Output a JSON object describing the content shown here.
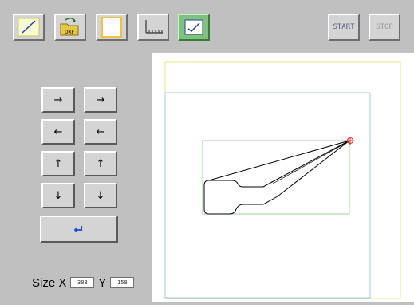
{
  "toolbar": {
    "buttons": [
      {
        "icon": "new-drawing-icon"
      },
      {
        "icon": "open-dxf-icon",
        "label": "DXF"
      },
      {
        "icon": "blank-frame-icon"
      },
      {
        "icon": "ruler-icon"
      },
      {
        "icon": "checkmark-view-icon",
        "active": true
      }
    ],
    "start_label": "START",
    "stop_label": "STOP"
  },
  "jog": {
    "buttons": [
      {
        "label": "→"
      },
      {
        "label": "→"
      },
      {
        "label": "←"
      },
      {
        "label": "←"
      },
      {
        "label": "↑"
      },
      {
        "label": "↑"
      },
      {
        "label": "↓"
      },
      {
        "label": "↓"
      }
    ],
    "enter_label": "↵"
  },
  "size": {
    "label": "Size X",
    "x_value": "308",
    "y_label": "Y",
    "y_value": "158"
  },
  "colors": {
    "background": "#c0c0c0",
    "canvas": "#ffffff",
    "outer_frame": "#e6e68a",
    "work_frame": "#9ec8e0",
    "bounding_box": "#9ed09e",
    "part_path": "#000000",
    "origin_marker": "#e03030",
    "active_button": "#7fc27f",
    "enter_arrow": "#2050d0"
  }
}
